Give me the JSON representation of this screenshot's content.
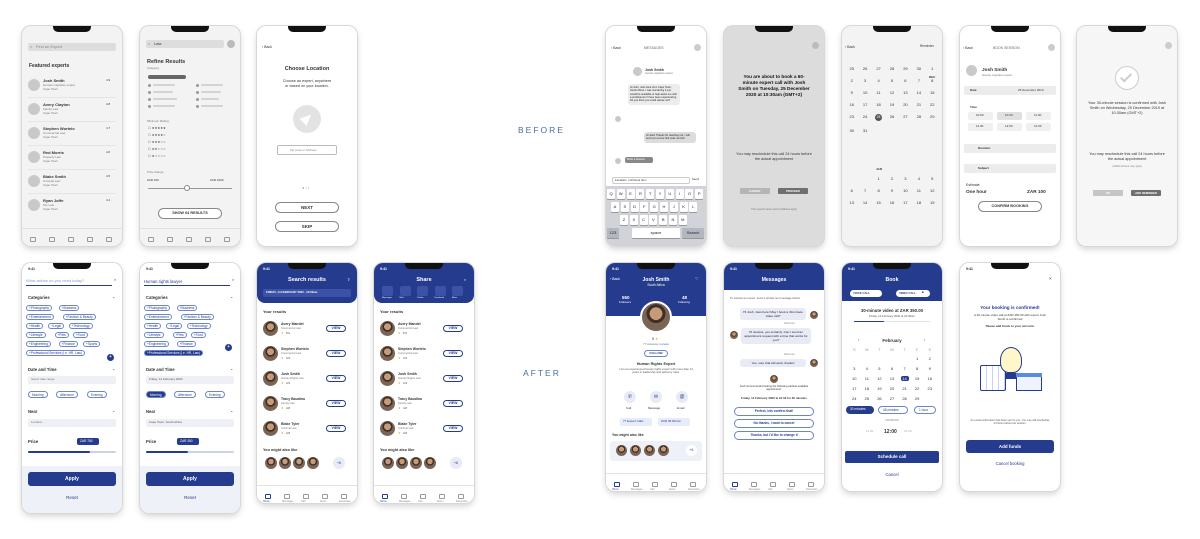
{
  "labels": {
    "before": "BEFORE",
    "after": "AFTER"
  },
  "b1": {
    "search_placeholder": "Find an Expert",
    "heading": "Featured experts",
    "experts": [
      {
        "name": "Josh Smith",
        "role": "Human migration expert",
        "rating": "4.9",
        "loc": "Cape Town"
      },
      {
        "name": "Avery Clayton",
        "role": "Family Law",
        "rating": "4.8",
        "loc": "Cape Town"
      },
      {
        "name": "Stephen Wortelo",
        "role": "Commercial Law",
        "rating": "4.7",
        "loc": "Cape Town"
      },
      {
        "name": "Red Morris",
        "role": "Property Law",
        "rating": "4.6",
        "loc": "Cape Town"
      },
      {
        "name": "Blake Smith",
        "role": "Criminal Law",
        "rating": "4.5",
        "loc": "Cape Town"
      },
      {
        "name": "Ryan Joffe",
        "role": "Tax Law",
        "rating": "4.4",
        "loc": "Cape Town"
      }
    ]
  },
  "b2": {
    "search_value": "Law",
    "title": "Refine Results",
    "category": "Category",
    "min_rating": "Minimum Rating",
    "price_range": "Price Range",
    "price_min": "ZAR 100",
    "price_max": "ZAR 1000",
    "show_button": "SHOW 64 RESULTS"
  },
  "b3": {
    "back": "Back",
    "title": "Choose Location",
    "subtitle": "Choose an expert, anywhere\nor based on your location.",
    "zip_placeholder": "Zip code or Address",
    "next": "NEXT",
    "skip": "SKIP"
  },
  "b4": {
    "back": "Back",
    "title": "MESSAGES",
    "name": "Josh Smith",
    "role": "Human migration expert",
    "msg1": "Hi Josh, Jess here from Cape Town, South Africa. I was wondering if you would be available to help assist me with a predicament I have been experiencing. Do you think you could advise me?",
    "msg2": "Hi Jess! Thanks for reaching out. I will send you a time that suits us both.",
    "book_label": "Book a Session",
    "input_value": "Fantastic, I will book then",
    "send": "Send",
    "keys_row1": [
      "Q",
      "W",
      "E",
      "R",
      "T",
      "Y",
      "U",
      "I",
      "O",
      "P"
    ],
    "keys_row2": [
      "A",
      "S",
      "D",
      "F",
      "G",
      "H",
      "J",
      "K",
      "L"
    ],
    "keys_row3": [
      "Z",
      "X",
      "C",
      "V",
      "B",
      "N",
      "M"
    ],
    "num_key": "123",
    "space": "space",
    "search_key": "Search"
  },
  "b5": {
    "text": "You are about to book a 60-minute expert call with Josh Smith on Tuesday, 25 December 2020 at 10:30am (GMT+2)",
    "reschedule": "You may reschedule this call 24 hours before the actual appointment",
    "cancel": "CANCEL",
    "proceed": "PROCEED",
    "fine": "The expert's terms and conditions apply"
  },
  "b6": {
    "back": "Back",
    "reminder": "Reminder",
    "month1": "DEC",
    "month2": "JAN",
    "rows1": [
      [
        "25",
        "26",
        "27",
        "28",
        "29",
        "30",
        "1"
      ],
      [
        "2",
        "3",
        "4",
        "5",
        "6",
        "7",
        "8"
      ],
      [
        "9",
        "10",
        "11",
        "12",
        "13",
        "14",
        "15"
      ],
      [
        "16",
        "17",
        "18",
        "19",
        "20",
        "21",
        "22"
      ],
      [
        "23",
        "24",
        "25",
        "26",
        "27",
        "28",
        "29"
      ],
      [
        "30",
        "31",
        "",
        "",
        "",
        "",
        ""
      ]
    ],
    "rows2": [
      [
        "",
        "",
        "1",
        "2",
        "3",
        "4",
        "5"
      ],
      [
        "6",
        "7",
        "8",
        "9",
        "10",
        "11",
        "12"
      ],
      [
        "13",
        "14",
        "15",
        "16",
        "17",
        "18",
        "19"
      ]
    ]
  },
  "b7": {
    "back": "Back",
    "title": "BOOK SESSION",
    "name": "Josh Smith",
    "role": "Human migration expert",
    "date_label": "Date",
    "date_value": "25 December 2019",
    "time_label": "Time",
    "times": [
      "10:00",
      "10:30",
      "11:00",
      "11:30",
      "12:00",
      "12:30"
    ],
    "duration": "Duration",
    "subject": "Subject",
    "estimate_label": "Estimate",
    "estimate_duration": "One hour",
    "estimate_price": "ZAR 100",
    "confirm": "CONFIRM BOOKING"
  },
  "b8": {
    "text": "Your 30-minute session is confirmed with Josh Smith on Wednesday, 25 December 2019 at 10:30am (GMT+2)",
    "reschedule": "You may reschedule this call 24 hours before the actual appointment",
    "fine": "Additional fees may apply",
    "ok": "OK",
    "add_reminder": "ADD REMINDER"
  },
  "a1": {
    "time": "9:41",
    "search_placeholder": "What advice do you need today?",
    "categories_label": "Categories",
    "chips": [
      "+Photography",
      "+Business",
      "+Entertainment",
      "+Fashion & Beauty",
      "+Health",
      "+Legal",
      "+Technology",
      "+Lifestyle",
      "+Pets",
      "+Food",
      "+Engineering",
      "+Finance",
      "+Sports",
      "+Professional Services (i.e. HR, Law)"
    ],
    "date_label": "Date and Time",
    "date_placeholder": "Select date range",
    "slots": [
      "Morning",
      "Afternoon",
      "Evening"
    ],
    "near_label": "Near",
    "near_placeholder": "Location",
    "price_label": "Price",
    "price_value": "ZAR 750",
    "apply": "Apply",
    "reset": "Reset"
  },
  "a2": {
    "time": "9:41",
    "search_value": "Human rights lawyer",
    "categories_label": "Categories",
    "chips": [
      "+Photography",
      "+Business",
      "+Entertainment",
      "+Fashion & Beauty",
      "+Health",
      "+Legal",
      "+Technology",
      "+Lifestyle",
      "+Pets",
      "+Food",
      "+Engineering",
      "+Finance",
      "+Professional Services (i.e. HR, Law)"
    ],
    "date_label": "Date and Time",
    "date_value": "Friday, 14 February 2020",
    "slots": [
      "Morning",
      "Afternoon",
      "Evening"
    ],
    "near_label": "Near",
    "near_value": "Cape Town, South Africa",
    "price_label": "Price",
    "price_value": "ZAR 350",
    "apply": "Apply",
    "reset": "Reset"
  },
  "a3": {
    "time": "9:41",
    "title": "Search results",
    "date_bar": "FRIDAY, 14 FEBRUARY 2020 · 10:00am",
    "results_label": "Your results",
    "view": "VIEW",
    "results": [
      {
        "name": "Avery Mandel",
        "role": "Commercial Law",
        "rating": "5.0"
      },
      {
        "name": "Stephen Wortelo",
        "role": "Commercial Law",
        "rating": "4.9"
      },
      {
        "name": "Josh Smith",
        "role": "Human Rights Law",
        "rating": "4.9"
      },
      {
        "name": "Tracy Baudinu",
        "role": "Family Law",
        "rating": "4.8"
      },
      {
        "name": "Blake Tyler",
        "role": "Criminal Law",
        "rating": "4.8"
      }
    ],
    "also_like": "You might also like",
    "more": "+6",
    "tabs": [
      "Home",
      "Messages",
      "Call",
      "Alerts",
      "Favourites"
    ]
  },
  "a4": {
    "time": "9:41",
    "title": "Share",
    "share_apps": [
      "Messages",
      "Mail",
      "Twitter",
      "Facebook",
      "More"
    ],
    "results_label": "Your results",
    "view": "VIEW",
    "results": [
      {
        "name": "Avery Mandel",
        "role": "Commercial Law",
        "rating": "5.0"
      },
      {
        "name": "Stephen Wortelo",
        "role": "Commercial Law",
        "rating": "4.9"
      },
      {
        "name": "Josh Smith",
        "role": "Human Rights Law",
        "rating": "4.9"
      },
      {
        "name": "Tracy Baudinu",
        "role": "Family Law",
        "rating": "4.8"
      },
      {
        "name": "Blake Tyler",
        "role": "Criminal Law",
        "rating": "4.8"
      }
    ],
    "also_like": "You might also like",
    "more": "+6",
    "tabs": [
      "Home",
      "Messages",
      "Call",
      "Alerts",
      "Favourites"
    ]
  },
  "a5": {
    "time": "9:41",
    "back": "Back",
    "name": "Josh Smith",
    "country": "South Africa",
    "followers": "550",
    "followers_label": "Followers",
    "following": "48",
    "following_label": "Following",
    "rating": "5",
    "reviews": "77 customer reviews",
    "follow": "FOLLOW",
    "headline": "Human Rights Expert",
    "bio": "I am an experienced human rights expert with more than 12 years in leadership and advisory roles.",
    "actions": [
      "Call",
      "Message",
      "Email"
    ],
    "calls": "77 Expert Calls",
    "price": "ZAR 35.00/min",
    "also_like": "You might also like",
    "more": "+6",
    "tabs": [
      "Home",
      "Messages",
      "Call",
      "Alerts",
      "Favourites"
    ]
  },
  "a6": {
    "time": "9:41",
    "title": "Messages",
    "intro": "To contact an expert, send a private text message below.",
    "m1": "Hi Josh, Jess here! May I book a 30-minute video call?",
    "delivered": "Delivered",
    "m2": "Hi Jessica, yes certainly. Can I send an appointment request with a time that works for you?",
    "m3": "Yes, sure that will work, thanks!",
    "notice": "Josh recommends booking the following earliest available appointment:",
    "slot": "Friday, 14 February 2020 at 10:00 for 30 minutes",
    "r1": "Perfect, lets confirm that!",
    "r2": "No thanks, I want to cancel",
    "r3": "Thanks, but I'd like to change it",
    "tabs": [
      "Home",
      "Messages",
      "Call",
      "Alerts",
      "Favourites"
    ]
  },
  "a7": {
    "time": "9:41",
    "title": "Book",
    "voice": "VOICE CALL",
    "video": "VIDEO CALL",
    "summary": "30-minute video at ZAR 350.00",
    "summary_sub": "Friday, 14 February 2020 at 10:00am",
    "month": "February",
    "dow": [
      "S",
      "M",
      "T",
      "W",
      "T",
      "F",
      "S"
    ],
    "rows": [
      [
        "",
        "",
        "",
        "",
        "",
        "1",
        "2"
      ],
      [
        "3",
        "4",
        "5",
        "6",
        "7",
        "8",
        "9"
      ],
      [
        "10",
        "11",
        "12",
        "13",
        "14",
        "15",
        "16"
      ],
      [
        "17",
        "18",
        "19",
        "20",
        "21",
        "22",
        "23"
      ],
      [
        "24",
        "25",
        "26",
        "27",
        "28",
        "29",
        ""
      ]
    ],
    "durations": [
      "30 minutes",
      "45 minutes",
      "1 hour"
    ],
    "am_label": "AM/MIN/PM",
    "clock": "12:00",
    "schedule": "Schedule call",
    "cancel": "Cancel"
  },
  "a8": {
    "time": "9:41",
    "title": "Your booking is confirmed!",
    "text": "A 30-minute video call at ZAR 350.00 with expert Josh Smith is confirmed",
    "sub": "Please add funds to your account.",
    "email_note": "An email confirmation has been sent to you. You may still reschedule 24 hours before the session.",
    "add_funds": "Add funds",
    "cancel_booking": "Cancel booking"
  }
}
